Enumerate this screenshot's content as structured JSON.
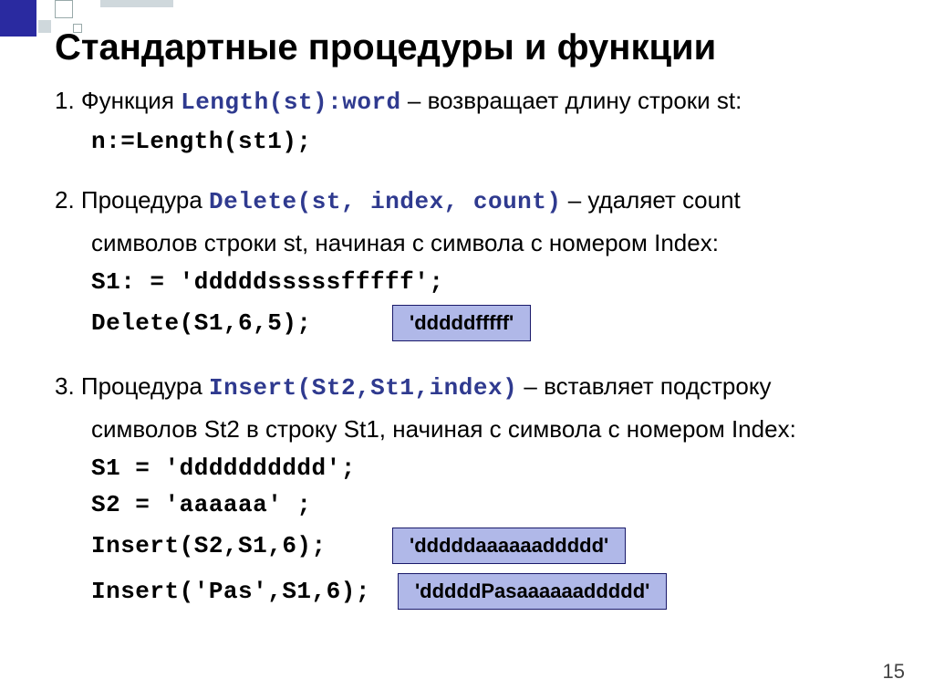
{
  "title": "Стандартные процедуры и функции",
  "item1": {
    "prefix": "1. Функция ",
    "code": "Length(st):word",
    "suffix": " – возвращает длину строки st:",
    "example": "n:=Length(st1);"
  },
  "item2": {
    "prefix": "2. Процедура ",
    "code": "Delete(st, index, count)",
    "suffix": " – удаляет count",
    "line2": "символов строки st, начиная с символа с номером Index:",
    "ex1": "S1: = 'dddddsssssfffff';",
    "ex2": "Delete(S1,6,5);",
    "result": "'dddddfffff'"
  },
  "item3": {
    "prefix": "3. Процедура ",
    "code": "Insert(St2,St1,index)",
    "suffix": " – вставляет подстроку",
    "line2": "символов St2 в строку St1, начиная с символа с номером Index:",
    "ex1": "S1 = 'dddddddddd';",
    "ex2": "S2 = 'aaaaaa' ;",
    "ex3": "Insert(S2,S1,6);",
    "ex4": "Insert('Pas',S1,6);",
    "result1": "'dddddaaaaaaddddd'",
    "result2": "'dddddPasaaaaaaddddd'"
  },
  "slide_number": "15"
}
